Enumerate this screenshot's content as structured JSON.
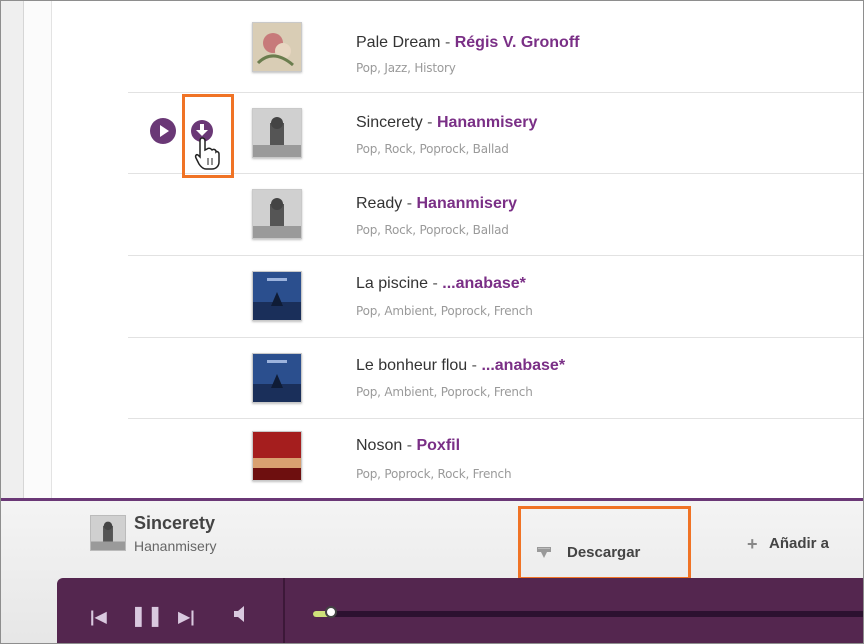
{
  "tracks": [
    {
      "title": "Pale Dream",
      "artist": "Régis V. Gronoff",
      "tags": "Pop, Jazz, History",
      "cover": "floral"
    },
    {
      "title": "Sincerety",
      "artist": "Hananmisery",
      "tags": "Pop, Rock, Poprock, Ballad",
      "cover": "tower"
    },
    {
      "title": "Ready",
      "artist": "Hananmisery",
      "tags": "Pop, Rock, Poprock, Ballad",
      "cover": "tower"
    },
    {
      "title": "La piscine",
      "artist": "...anabase*",
      "tags": "Pop, Ambient, Poprock, French",
      "cover": "tree"
    },
    {
      "title": "Le bonheur flou",
      "artist": "...anabase*",
      "tags": "Pop, Ambient, Poprock, French",
      "cover": "tree"
    },
    {
      "title": "Noson",
      "artist": "Poxfil",
      "tags": "Pop, Poprock, Rock, French",
      "cover": "red"
    }
  ],
  "separator": "-",
  "now_playing": {
    "title": "Sincerety",
    "artist": "Hananmisery"
  },
  "actions": {
    "download": "Descargar",
    "add_to": "Añadir a"
  },
  "icons": {
    "row_play": "play-icon",
    "row_download": "download-icon",
    "download_button": "download-icon",
    "add_button": "plus-icon",
    "prev": "previous-icon",
    "pause": "pause-icon",
    "next": "next-icon",
    "volume": "volume-icon",
    "cursor": "hand-pointer-icon"
  },
  "colors": {
    "accent": "#6a3876",
    "highlight": "#f07325",
    "player_bg": "#54264f",
    "progress": "#cfe17a"
  },
  "playback": {
    "progress_percent": 2
  }
}
